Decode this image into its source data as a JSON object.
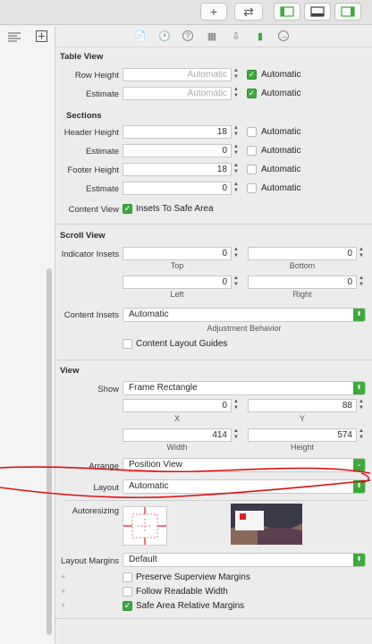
{
  "toolbar": {
    "add": "+",
    "swap": "⇄"
  },
  "tabs": [
    "📄",
    "🕐",
    "?",
    "▦",
    "⇩",
    "▮",
    "→"
  ],
  "table_view": {
    "title": "Table View",
    "row_height": {
      "label": "Row Height",
      "value": "Automatic",
      "check": "Automatic"
    },
    "estimate": {
      "label": "Estimate",
      "value": "Automatic",
      "check": "Automatic"
    }
  },
  "sections": {
    "title": "Sections",
    "header_height": {
      "label": "Header Height",
      "value": "18",
      "check": "Automatic"
    },
    "header_estimate": {
      "label": "Estimate",
      "value": "0",
      "check": "Automatic"
    },
    "footer_height": {
      "label": "Footer Height",
      "value": "18",
      "check": "Automatic"
    },
    "footer_estimate": {
      "label": "Estimate",
      "value": "0",
      "check": "Automatic"
    },
    "content_view": {
      "label": "Content View",
      "check": "Insets To Safe Area"
    }
  },
  "scroll_view": {
    "title": "Scroll View",
    "indicator_insets": {
      "label": "Indicator Insets",
      "top": "0",
      "bottom": "0",
      "left": "0",
      "right": "0",
      "top_label": "Top",
      "bottom_label": "Bottom",
      "left_label": "Left",
      "right_label": "Right"
    },
    "content_insets": {
      "label": "Content Insets",
      "value": "Automatic",
      "caption": "Adjustment Behavior"
    },
    "layout_guides": "Content Layout Guides"
  },
  "view": {
    "title": "View",
    "show": {
      "label": "Show",
      "value": "Frame Rectangle"
    },
    "x": {
      "value": "0",
      "label": "X"
    },
    "y": {
      "value": "88",
      "label": "Y"
    },
    "width": {
      "value": "414",
      "label": "Width"
    },
    "height": {
      "value": "574",
      "label": "Height"
    },
    "arrange": {
      "label": "Arrange",
      "value": "Position View"
    },
    "layout": {
      "label": "Layout",
      "value": "Automatic"
    },
    "autoresizing": {
      "label": "Autoresizing"
    },
    "layout_margins": {
      "label": "Layout Margins",
      "value": "Default"
    },
    "preserve": "Preserve Superview Margins",
    "follow": "Follow Readable Width",
    "safe_area": "Safe Area Relative Margins"
  },
  "colors": {
    "accent": "#3cab3c",
    "annotation": "#e01010"
  }
}
